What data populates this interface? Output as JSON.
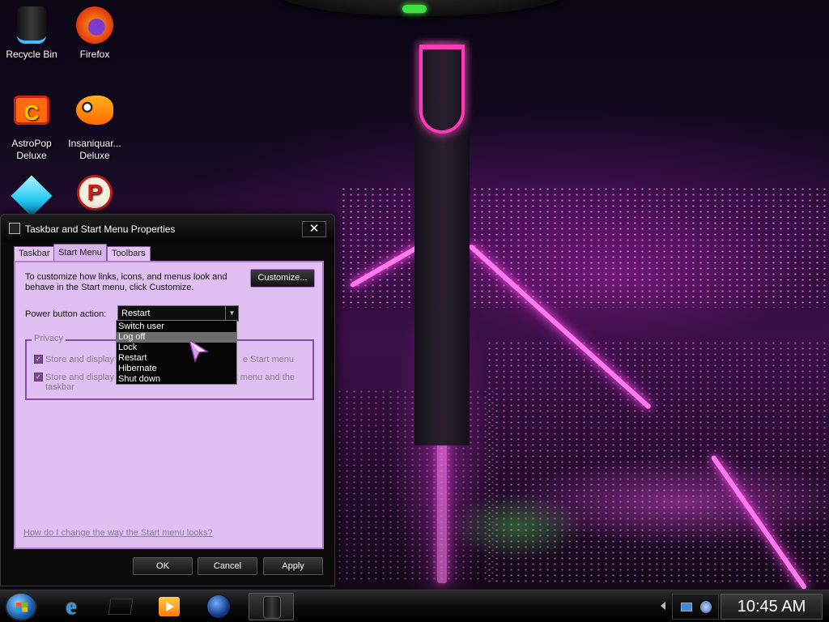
{
  "desktop": {
    "icons": [
      {
        "label": "Recycle Bin",
        "icon": "recycle-bin-icon"
      },
      {
        "label": "Firefox",
        "icon": "firefox-icon"
      },
      {
        "label": "AstroPop Deluxe",
        "icon": "astropop-icon"
      },
      {
        "label": "Insaniquar... Deluxe",
        "icon": "insaniquarium-icon"
      },
      {
        "label": "",
        "icon": "bejeweled-gem-icon"
      },
      {
        "label": "",
        "icon": "peggle-icon"
      }
    ]
  },
  "dialog": {
    "title": "Taskbar and Start Menu Properties",
    "close_glyph": "✕",
    "tabs": [
      {
        "label": "Taskbar",
        "active": false
      },
      {
        "label": "Start Menu",
        "active": true
      },
      {
        "label": "Toolbars",
        "active": false
      }
    ],
    "intro_text": "To customize how links, icons, and menus look and behave in the Start menu, click Customize.",
    "customize_button": "Customize...",
    "power_label": "Power button action:",
    "power_value": "Restart",
    "privacy": {
      "legend": "Privacy",
      "item1": "Store and display",
      "item1_tail": "e Start menu",
      "item2": "Store and display",
      "item2_wrap": "taskbar",
      "item2_tail": "rt menu and the"
    },
    "help_link": "How do I change the way the Start menu looks?",
    "buttons": {
      "ok": "OK",
      "cancel": "Cancel",
      "apply": "Apply"
    }
  },
  "dropdown": {
    "options": [
      "Switch user",
      "Log off",
      "Lock",
      "Restart",
      "Hibernate",
      "Shut down"
    ],
    "highlighted": "Log off"
  },
  "taskbar": {
    "pinned": [
      "internet-explorer-icon",
      "dark-box-icon",
      "media-player-icon",
      "globe-icon",
      "window-app-icon"
    ],
    "active": "window-app-icon",
    "clock": "10:45 AM"
  },
  "colors": {
    "dialog_panel": "#e0bff2",
    "accent_purple": "#b57cd1",
    "neon_pink": "#ff3ab8"
  }
}
